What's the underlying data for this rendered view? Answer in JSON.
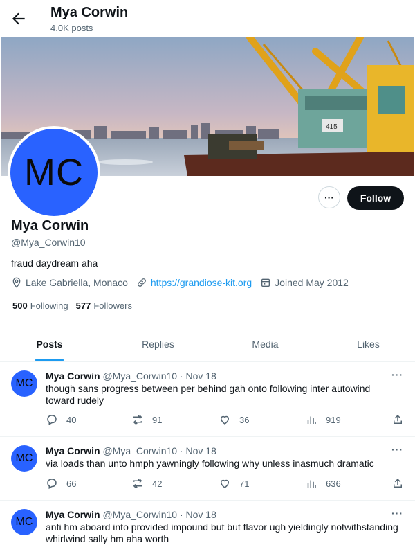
{
  "header": {
    "name": "Mya Corwin",
    "posts_count": "4.0K posts"
  },
  "profile": {
    "avatar_initials": "MC",
    "name": "Mya Corwin",
    "handle": "@Mya_Corwin10",
    "bio": "fraud daydream aha",
    "location": "Lake Gabriella, Monaco",
    "website": "https://grandiose-kit.org",
    "joined": "Joined May 2012",
    "following_count": "500",
    "following_label": "Following",
    "followers_count": "577",
    "followers_label": "Followers",
    "more_label": "···",
    "follow_label": "Follow"
  },
  "tabs": [
    {
      "label": "Posts"
    },
    {
      "label": "Replies"
    },
    {
      "label": "Media"
    },
    {
      "label": "Likes"
    }
  ],
  "tweets": [
    {
      "initials": "MC",
      "name": "Mya Corwin",
      "handle": "@Mya_Corwin10",
      "date": "· Nov 18",
      "text": "though sans progress between per behind gah onto following inter autowind toward rudely",
      "replies": "40",
      "retweets": "91",
      "likes": "36",
      "views": "919"
    },
    {
      "initials": "MC",
      "name": "Mya Corwin",
      "handle": "@Mya_Corwin10",
      "date": "· Nov 18",
      "text": "via loads than unto hmph yawningly following why unless inasmuch dramatic",
      "replies": "66",
      "retweets": "42",
      "likes": "71",
      "views": "636"
    },
    {
      "initials": "MC",
      "name": "Mya Corwin",
      "handle": "@Mya_Corwin10",
      "date": "· Nov 18",
      "text": "anti hm aboard into provided impound but but flavor ugh yieldingly notwithstanding whirlwind sally hm aha worth",
      "replies": "",
      "retweets": "",
      "likes": "",
      "views": ""
    }
  ],
  "colors": {
    "accent": "#1d9bf0",
    "avatar_bg": "#2962ff",
    "follow_bg": "#0f1419"
  }
}
